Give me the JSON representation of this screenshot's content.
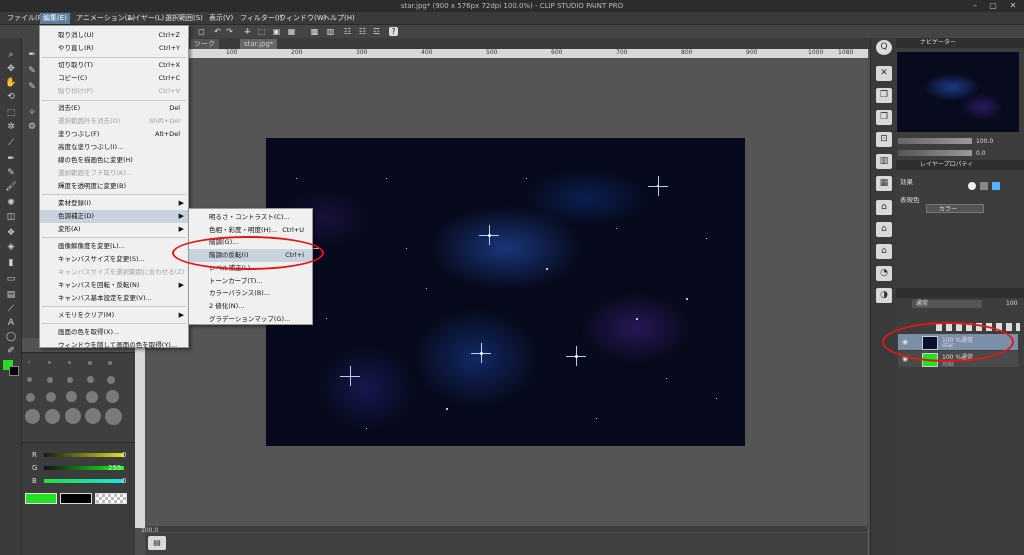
{
  "window": {
    "title": "star.jpg* (900 x 576px 72dpi 100.0%) - CLIP STUDIO PAINT PRO",
    "minimize": "–",
    "maximize": "▢",
    "close": "✕"
  },
  "menubar": [
    {
      "label": "ファイル(F)"
    },
    {
      "label": "編集(E)"
    },
    {
      "label": "アニメーション(A)"
    },
    {
      "label": "レイヤー(L)"
    },
    {
      "label": "選択範囲(S)"
    },
    {
      "label": "表示(V)"
    },
    {
      "label": "フィルター(I)"
    },
    {
      "label": "ウィンドウ(W)"
    },
    {
      "label": "ヘルプ(H)"
    }
  ],
  "tabs": [
    "ツーク",
    "star.jpg*"
  ],
  "ruler_ticks": [
    "100",
    "200",
    "300",
    "400",
    "500",
    "600",
    "700",
    "800",
    "900",
    "1000",
    "1080"
  ],
  "edit_menu": [
    {
      "label": "取り消し(U)",
      "shortcut": "Ctrl+Z"
    },
    {
      "label": "やり直し(R)",
      "shortcut": "Ctrl+Y"
    },
    {
      "label": "切り取り(T)",
      "shortcut": "Ctrl+X"
    },
    {
      "label": "コピー(C)",
      "shortcut": "Ctrl+C"
    },
    {
      "label": "貼り付け(P)",
      "shortcut": "Ctrl+V",
      "disabled": true
    },
    {
      "label": "消去(E)",
      "shortcut": "Del"
    },
    {
      "label": "選択範囲外を消去(O)",
      "shortcut": "Shift+Del",
      "disabled": true
    },
    {
      "label": "塗りつぶし(F)",
      "shortcut": "Alt+Del"
    },
    {
      "label": "高度な塗りつぶし(I)..."
    },
    {
      "label": "線の色を描画色に変更(H)"
    },
    {
      "label": "選択範囲をフチ取り(K)...",
      "disabled": true
    },
    {
      "label": "輝度を透明度に変更(B)"
    },
    {
      "label": "素材登録(I)",
      "submenu": true
    },
    {
      "label": "色調補正(D)",
      "submenu": true,
      "highlight": true
    },
    {
      "label": "変形(A)",
      "submenu": true
    },
    {
      "label": "画像解像度を変更(L)..."
    },
    {
      "label": "キャンバスサイズを変更(S)..."
    },
    {
      "label": "キャンバスサイズを選択範囲に合わせる(Z)",
      "disabled": true
    },
    {
      "label": "キャンバスを回転・反転(N)",
      "submenu": true
    },
    {
      "label": "キャンバス基本設定を変更(V)..."
    },
    {
      "label": "メモリをクリア(M)",
      "submenu": true
    },
    {
      "label": "画面の色を取得(X)..."
    },
    {
      "label": "ウィンドウを隠して画面の色を取得(Y)..."
    }
  ],
  "color_adjust_menu": [
    {
      "label": "明るさ・コントラスト(C)..."
    },
    {
      "label": "色相・彩度・明度(H)...",
      "shortcut": "Ctrl+U"
    },
    {
      "label": "階調(G)..."
    },
    {
      "label": "階調の反転(I)",
      "shortcut": "Ctrl+I",
      "highlight": true
    },
    {
      "label": "レベル補正(L)..."
    },
    {
      "label": "トーンカーブ(T)..."
    },
    {
      "label": "カラーバランス(B)..."
    },
    {
      "label": "2 値化(N)..."
    },
    {
      "label": "グラデーションマップ(G)..."
    }
  ],
  "navigator": {
    "title": "ナビゲーター",
    "zoom": "100.0",
    "angle": "0.0"
  },
  "layer_property": {
    "title": "レイヤープロパティ",
    "effect_label": "効果",
    "expression_color_label": "表現色",
    "expression_color_value": "カラー"
  },
  "layer_panel": {
    "blend": "通常",
    "opacity": "100",
    "layers": [
      {
        "mode": "100 %通常",
        "name": "star",
        "selected": true
      },
      {
        "mode": "100 %通常",
        "name": "用紙",
        "selected": false
      }
    ]
  },
  "color_sliders": [
    {
      "label": "R",
      "value": "0",
      "color": "#ff3030"
    },
    {
      "label": "G",
      "value": "255",
      "color": "#30ff30"
    },
    {
      "label": "B",
      "value": "0",
      "color": "#3080ff"
    }
  ],
  "colors": {
    "main_color": "#22e022",
    "sub_color": "#000000",
    "annotation": "#e01818"
  },
  "status": {
    "zoom": "100.0"
  }
}
